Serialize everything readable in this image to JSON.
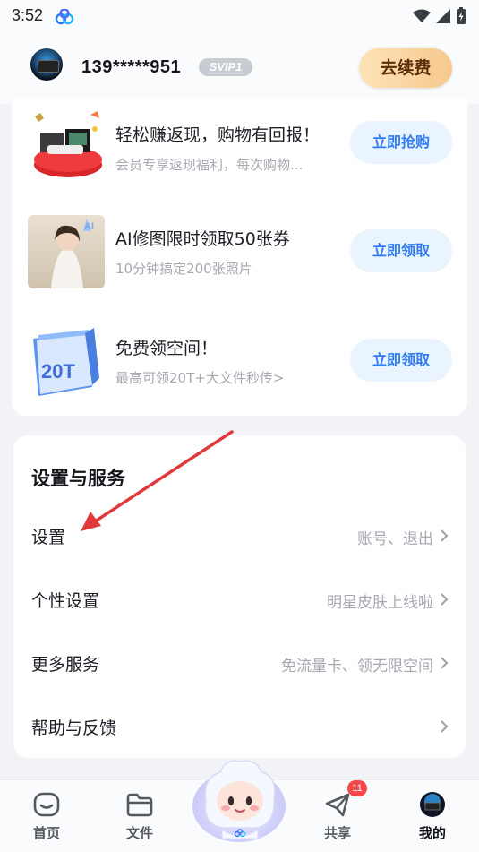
{
  "status_bar": {
    "time": "3:52"
  },
  "header": {
    "phone": "139*****951",
    "badge": "SVIP1",
    "renew_label": "去续费"
  },
  "promos": [
    {
      "title": "轻松赚返现，购物有回报！",
      "subtitle": "会员专享返现福利，每次购物...",
      "button": "立即抢购"
    },
    {
      "title": "AI修图限时领取50张券",
      "subtitle": "10分钟搞定200张照片",
      "button": "立即领取"
    },
    {
      "title": "免费领空间！",
      "subtitle": "最高可领20T+大文件秒传>",
      "button": "立即领取",
      "image_text": "20T"
    }
  ],
  "settings": {
    "title": "设置与服务",
    "rows": [
      {
        "label": "设置",
        "value": "账号、退出"
      },
      {
        "label": "个性设置",
        "value": "明星皮肤上线啦"
      },
      {
        "label": "更多服务",
        "value": "免流量卡、领无限空间"
      },
      {
        "label": "帮助与反馈",
        "value": ""
      }
    ]
  },
  "tab_bar": {
    "tabs": [
      {
        "label": "首页",
        "icon": "home-icon"
      },
      {
        "label": "文件",
        "icon": "folder-icon"
      },
      {
        "label": "共享",
        "icon": "share-icon",
        "badge": "11"
      },
      {
        "label": "我的",
        "icon": "avatar-icon",
        "active": true
      }
    ]
  },
  "colors": {
    "accent": "#2f7cf0",
    "button_bg": "#eaf4ff",
    "renew_gradient_start": "#fde3b8",
    "renew_gradient_end": "#f7c88d",
    "annotation_arrow": "#e0393b",
    "badge": "#f5484a"
  }
}
